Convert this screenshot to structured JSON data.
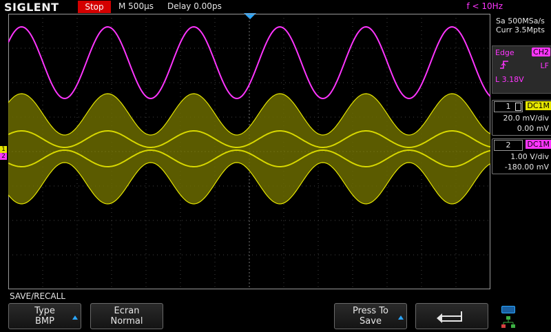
{
  "header": {
    "brand": "SIGLENT",
    "run_state": "Stop",
    "timebase": "M 500µs",
    "delay": "Delay 0.00ps",
    "trigger_freq": "f < 10Hz"
  },
  "acquisition": {
    "sample_rate": "Sa 500MSa/s",
    "memory": "Curr 3.5Mpts"
  },
  "trigger": {
    "type": "Edge",
    "source": "CH2",
    "coupling": "LF",
    "level": "L  3.18V"
  },
  "channels": [
    {
      "num": "1",
      "coupling": "DC1M",
      "volts_div": "20.0 mV/div",
      "offset": "0.00 mV",
      "color": "#e6e600"
    },
    {
      "num": "2",
      "coupling": "DC1M",
      "volts_div": "1.00 V/div",
      "offset": "-180.00 mV",
      "color": "#ff35ff"
    }
  ],
  "menu": {
    "title": "SAVE/RECALL",
    "softkeys": [
      {
        "line1": "Type",
        "line2": "BMP"
      },
      {
        "line1": "Ecran",
        "line2": "Normal"
      },
      {
        "line1": "Press To",
        "line2": "Save"
      }
    ]
  },
  "icons": {
    "return": "return-arrow-icon",
    "usb": "usb-icon",
    "network": "network-icon",
    "trigger_slope": "rising-edge-icon"
  }
}
